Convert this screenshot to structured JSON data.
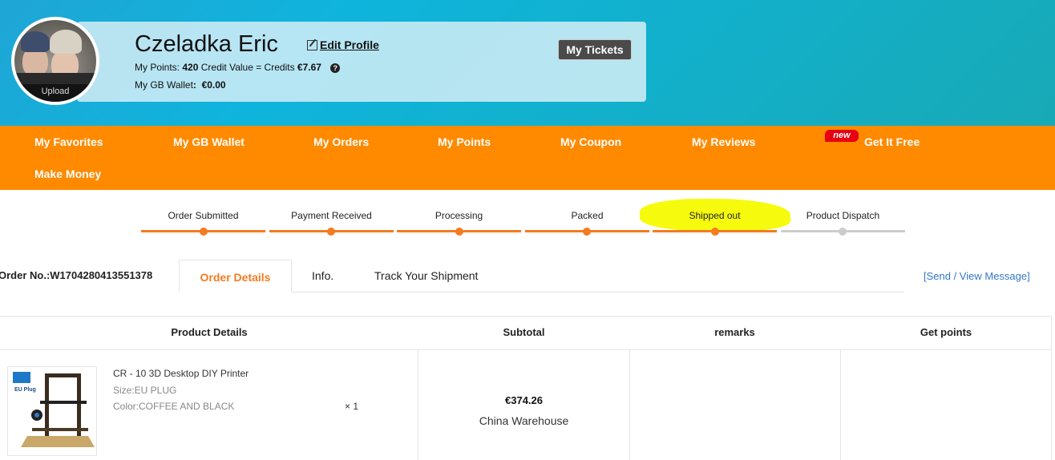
{
  "profile": {
    "avatar_overlay": "Upload",
    "name": "Czeladka Eric",
    "edit_label": "Edit Profile",
    "points_label": "My Points:",
    "points_value": "420",
    "credit_label": "Credit Value = Credits",
    "credit_value": "€7.67",
    "wallet_label": "My GB Wallet",
    "wallet_value": "€0.00",
    "tickets_label": "My Tickets"
  },
  "nav": {
    "items": [
      {
        "label": "My Favorites"
      },
      {
        "label": "My GB Wallet"
      },
      {
        "label": "My Orders"
      },
      {
        "label": "My Points"
      },
      {
        "label": "My Coupon"
      },
      {
        "label": "My Reviews"
      },
      {
        "label": "Get It Free"
      },
      {
        "label": "Make Money"
      }
    ],
    "new_badge": "new"
  },
  "steps": [
    {
      "label": "Order Submitted",
      "done": true
    },
    {
      "label": "Payment Received",
      "done": true
    },
    {
      "label": "Processing",
      "done": true
    },
    {
      "label": "Packed",
      "done": true
    },
    {
      "label": "Shipped out",
      "done": true
    },
    {
      "label": "Product Dispatch",
      "done": false
    }
  ],
  "order": {
    "number_label": "Order No.:W1704280413551378",
    "tabs": [
      "Order Details",
      "Info.",
      "Track Your Shipment"
    ],
    "send_message": "[Send / View Message]"
  },
  "table": {
    "headers": [
      "Product Details",
      "Subtotal",
      "remarks",
      "Get points"
    ],
    "item": {
      "title": "CR - 10 3D Desktop DIY Printer",
      "size": "Size:EU PLUG",
      "color": "Color:COFFEE AND BLACK",
      "qty": "× 1",
      "price": "€374.26",
      "warehouse": "China Warehouse",
      "image_tag": "EU Plug"
    }
  },
  "colors": {
    "accent": "#ff8a00",
    "step_done": "#f47b20",
    "step_pending": "#cccccc",
    "link": "#3478c5",
    "highlight": "#f6fb00"
  }
}
